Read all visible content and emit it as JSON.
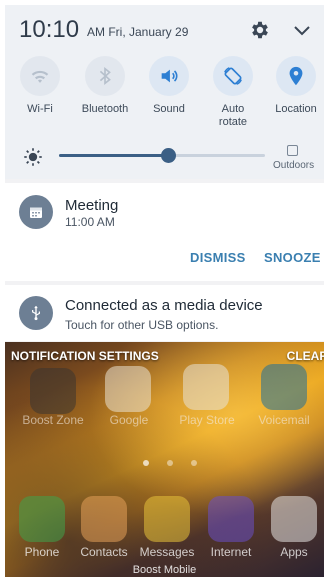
{
  "status": {
    "time": "10:10",
    "ampm_date": "AM Fri, January 29"
  },
  "quick_tiles": [
    {
      "label": "Wi-Fi",
      "icon": "wifi-icon"
    },
    {
      "label": "Bluetooth",
      "icon": "bluetooth-icon"
    },
    {
      "label": "Sound",
      "icon": "sound-icon"
    },
    {
      "label": "Auto\nrotate",
      "icon": "auto-rotate-icon"
    },
    {
      "label": "Location",
      "icon": "location-icon"
    }
  ],
  "brightness": {
    "level": 0.53,
    "outdoors_label": "Outdoors"
  },
  "notifications": [
    {
      "title": "Meeting",
      "subtitle": "11:00 AM",
      "actions": [
        "DISMISS",
        "SNOOZE"
      ],
      "icon": "calendar-icon"
    },
    {
      "title": "Connected as a media device",
      "subtitle": "Touch for other USB options.",
      "icon": "usb-icon"
    }
  ],
  "notif_bar": {
    "settings_label": "NOTIFICATION SETTINGS",
    "clear_label": "CLEAR"
  },
  "home_apps": [
    {
      "label": "Boost Zone"
    },
    {
      "label": "Google"
    },
    {
      "label": "Play Store"
    },
    {
      "label": "Voicemail"
    }
  ],
  "dock_apps": [
    {
      "label": "Phone"
    },
    {
      "label": "Contacts"
    },
    {
      "label": "Messages"
    },
    {
      "label": "Internet"
    },
    {
      "label": "Apps"
    }
  ],
  "carrier": "Boost Mobile",
  "colors": {
    "accent": "#3a7fb0",
    "tile_blue": "#2d7fd3",
    "slider": "#3b5f85"
  }
}
